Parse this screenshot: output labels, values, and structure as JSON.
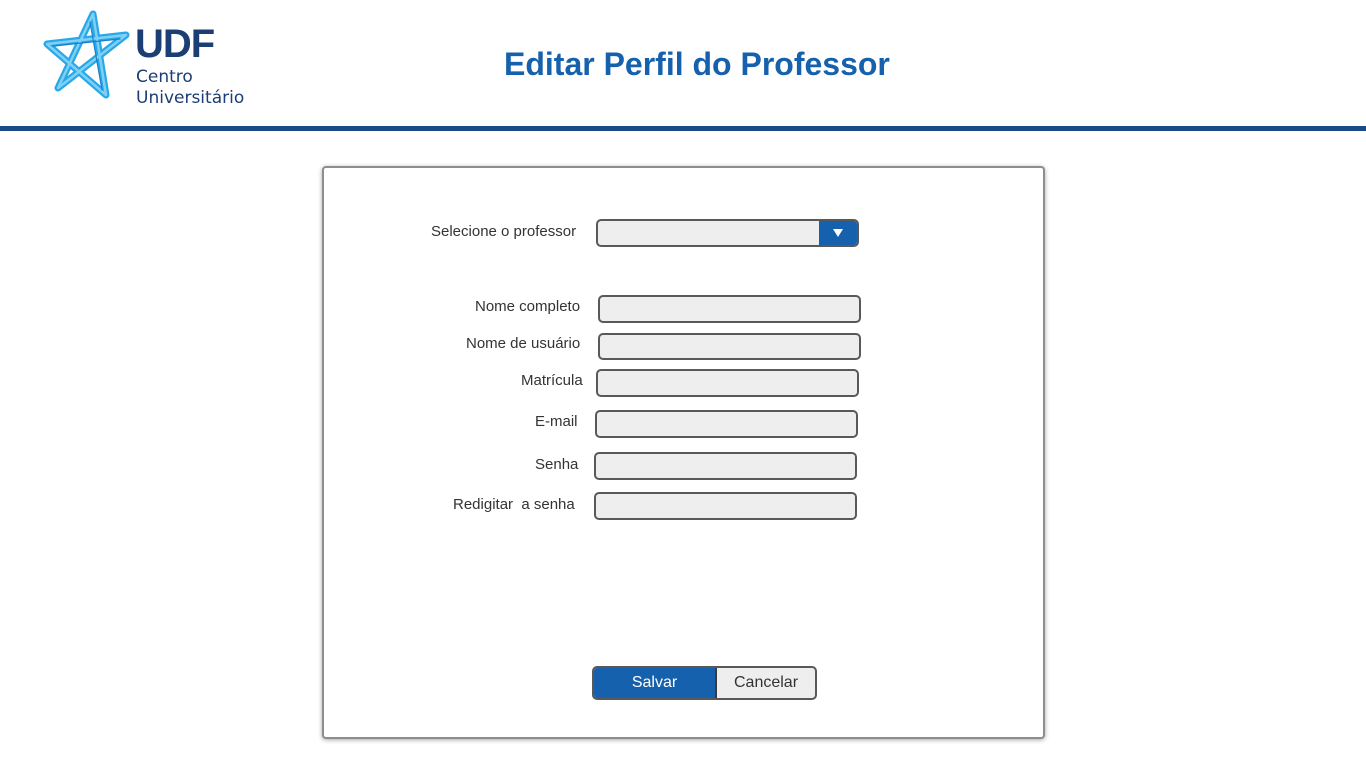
{
  "header": {
    "logo": {
      "abbreviation": "UDF",
      "line1": "Centro",
      "line2": "Universitário"
    },
    "title": "Editar Perfil do Professor"
  },
  "form": {
    "professor_select": {
      "label": "Selecione o professor",
      "value": ""
    },
    "full_name": {
      "label": "Nome completo",
      "value": ""
    },
    "username": {
      "label": "Nome de usuário",
      "value": ""
    },
    "registration": {
      "label": "Matrícula",
      "value": ""
    },
    "email": {
      "label": "E-mail",
      "value": ""
    },
    "password": {
      "label": "Senha",
      "value": ""
    },
    "confirm_password": {
      "label": "Redigitar  a senha",
      "value": ""
    }
  },
  "actions": {
    "save_label": "Salvar",
    "cancel_label": "Cancelar"
  },
  "colors": {
    "brand_blue": "#1661ad",
    "header_rule": "#1b4b86",
    "logo_navy": "#1b3e74",
    "logo_star": "#29a8e8",
    "input_bg": "#eeeeee"
  },
  "icons": {
    "select_arrow": "triangle-down-icon",
    "logo": "star-logo-icon"
  }
}
